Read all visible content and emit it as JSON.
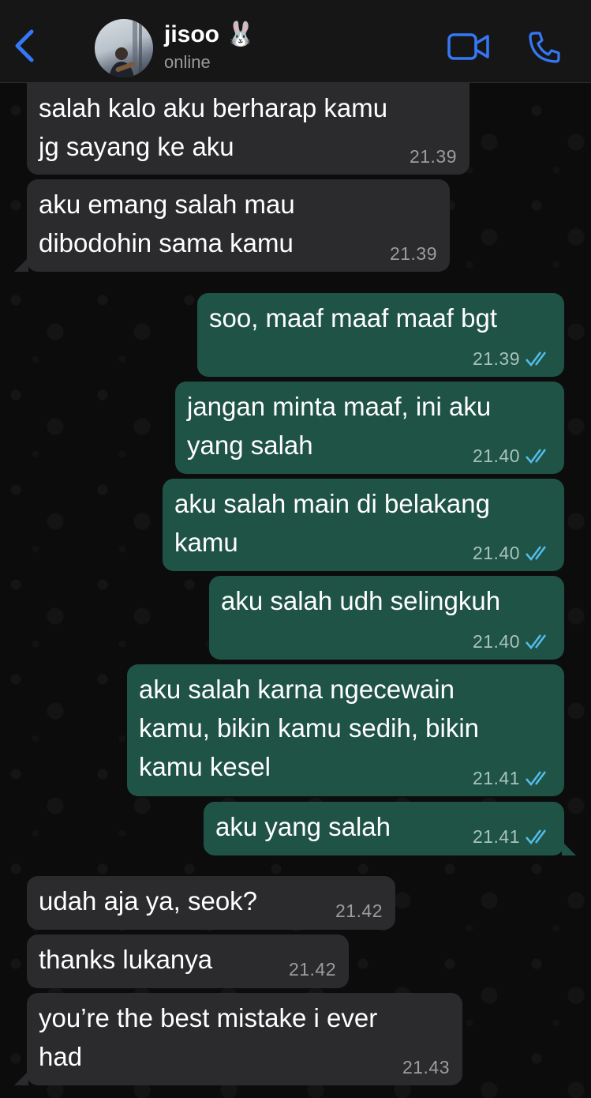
{
  "header": {
    "contact_name": "jisoo 🐰",
    "status": "online",
    "icons": {
      "back": "chevron-left-icon",
      "video": "video-camera-icon",
      "call": "phone-icon"
    }
  },
  "colors": {
    "accent": "#3478f6",
    "incoming_bubble": "#2b2b2d",
    "outgoing_bubble": "#1f5346",
    "read_tick": "#53bdeb"
  },
  "messages": [
    {
      "direction": "in",
      "text": "salah kalo aku berharap kamu\njg sayang ke aku",
      "time": "21.39"
    },
    {
      "direction": "in",
      "text": "aku emang salah mau\ndibodohin sama kamu",
      "time": "21.39"
    },
    {
      "direction": "out",
      "text": "soo, maaf maaf maaf bgt",
      "time": "21.39",
      "status": "read"
    },
    {
      "direction": "out",
      "text": "jangan minta maaf, ini aku\nyang salah",
      "time": "21.40",
      "status": "read"
    },
    {
      "direction": "out",
      "text": "aku salah main di belakang\nkamu",
      "time": "21.40",
      "status": "read"
    },
    {
      "direction": "out",
      "text": "aku salah udh selingkuh",
      "time": "21.40",
      "status": "read"
    },
    {
      "direction": "out",
      "text": "aku salah karna ngecewain\nkamu, bikin kamu sedih, bikin\nkamu kesel",
      "time": "21.41",
      "status": "read"
    },
    {
      "direction": "out",
      "text": "aku yang salah",
      "time": "21.41",
      "status": "read"
    },
    {
      "direction": "in",
      "text": "udah aja ya, seok?",
      "time": "21.42"
    },
    {
      "direction": "in",
      "text": "thanks lukanya",
      "time": "21.42"
    },
    {
      "direction": "in",
      "text": "you’re the best mistake i ever\nhad",
      "time": "21.43"
    }
  ]
}
